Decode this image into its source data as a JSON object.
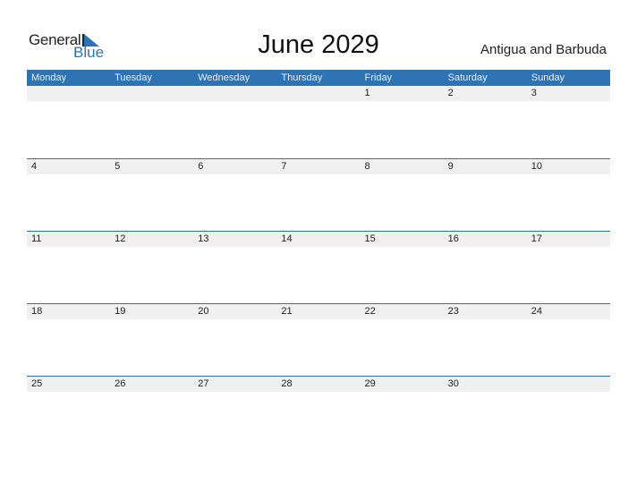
{
  "logo": {
    "general": "General",
    "blue": "Blue"
  },
  "title": "June 2029",
  "country": "Antigua and Barbuda",
  "colors": {
    "accent": "#2e74b5",
    "band": "#f0f0f0"
  },
  "weekdays": [
    "Monday",
    "Tuesday",
    "Wednesday",
    "Thursday",
    "Friday",
    "Saturday",
    "Sunday"
  ],
  "weeks": [
    [
      "",
      "",
      "",
      "",
      "1",
      "2",
      "3"
    ],
    [
      "4",
      "5",
      "6",
      "7",
      "8",
      "9",
      "10"
    ],
    [
      "11",
      "12",
      "13",
      "14",
      "15",
      "16",
      "17"
    ],
    [
      "18",
      "19",
      "20",
      "21",
      "22",
      "23",
      "24"
    ],
    [
      "25",
      "26",
      "27",
      "28",
      "29",
      "30",
      ""
    ]
  ]
}
